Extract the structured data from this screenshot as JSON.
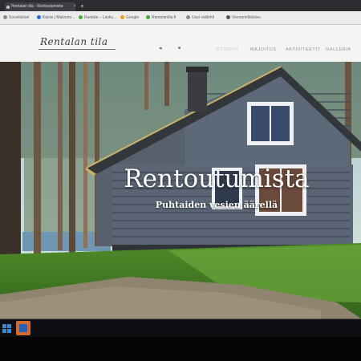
{
  "browser": {
    "active_tab_title": "Rentalan tila - Rentoutumista",
    "new_tab_symbol": "+",
    "close_symbol": "×",
    "bookmarks": [
      {
        "label": "Sovellukset",
        "color": "#8a8a8a"
      },
      {
        "label": "Kipsis | Maksuto...",
        "color": "#2c6bd4"
      },
      {
        "label": "Rantala – Lasku...",
        "color": "#49a83b"
      },
      {
        "label": "Google",
        "color": "#e2a020"
      },
      {
        "label": "Rantalantila.fi",
        "color": "#49a83b"
      },
      {
        "label": "Uusi välilehti",
        "color": "#8a8a8a"
      },
      {
        "label": "Vierasmökkisivu",
        "color": "#555555"
      }
    ]
  },
  "site": {
    "logo": "Rentalan tila",
    "header_icons": [
      "◂",
      "■"
    ],
    "nav": [
      "ETUSIVU",
      "MAJOITUS",
      "AKTIVITEETIT",
      "GALLERIA"
    ]
  },
  "hero": {
    "title": "Rentoutumista",
    "subtitle": "Puhtaiden vesien äärellä"
  },
  "colors": {
    "accent": "#d46a33",
    "header_bg": "#f4f4f2",
    "log_cabin": "#5b6575"
  }
}
